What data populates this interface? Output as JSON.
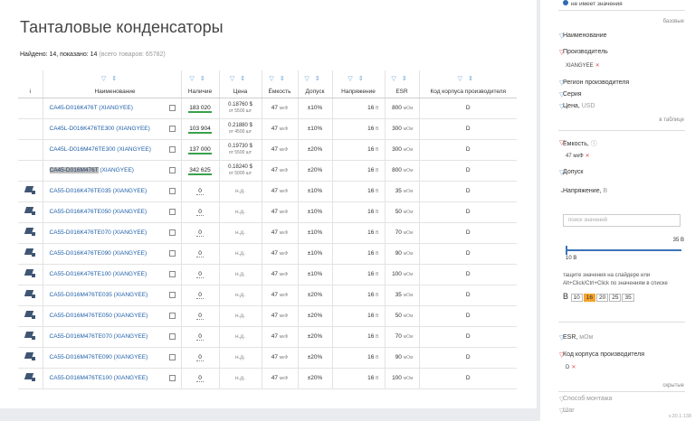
{
  "page_title": "Танталовые конденсаторы",
  "found": {
    "label": "Найдено: 14, показано: 14",
    "total": "(всего товаров: 65782)"
  },
  "columns": {
    "info": "i",
    "name": "Наименование",
    "stock": "Наличие",
    "price": "Цена",
    "capacity": "Ёмкость",
    "tolerance": "Допуск",
    "voltage": "Напряжение",
    "esr": "ESR",
    "package": "Код корпуса производителя"
  },
  "units": {
    "cap": "мкФ",
    "volt": "В",
    "esr": "мОм"
  },
  "rows": [
    {
      "name": "CA45-D016K476T (XIANGYEE)",
      "stock": "183 020",
      "price": "0.18760 $",
      "price_note": "от 5500 шт",
      "cap": "47",
      "tol": "±10%",
      "volt": "16",
      "esr": "800",
      "pkg": "D",
      "img": false
    },
    {
      "name": "CA45L-D016K476TE300 (XIANGYEE)",
      "stock": "103 904",
      "price": "0.21880 $",
      "price_note": "от 4500 шт",
      "cap": "47",
      "tol": "±10%",
      "volt": "16",
      "esr": "300",
      "pkg": "D",
      "img": false
    },
    {
      "name": "CA45L-D016M476TE300 (XIANGYEE)",
      "stock": "137 000",
      "price": "0.19730 $",
      "price_note": "от 5500 шт",
      "cap": "47",
      "tol": "±20%",
      "volt": "16",
      "esr": "300",
      "pkg": "D",
      "img": false
    },
    {
      "name_hl": "CA45-D016M476T",
      "name_rest": " (XIANGYEE)",
      "stock": "342 625",
      "price": "0.18240 $",
      "price_note": "от 5000 шт",
      "cap": "47",
      "tol": "±20%",
      "volt": "16",
      "esr": "800",
      "pkg": "D",
      "img": false
    },
    {
      "name": "CA55-D016K476TE035 (XIANGYEE)",
      "stock": "0",
      "price": "н.д.",
      "cap": "47",
      "tol": "±10%",
      "volt": "16",
      "esr": "35",
      "pkg": "D",
      "img": true
    },
    {
      "name": "CA55-D016K476TE050 (XIANGYEE)",
      "stock": "0",
      "price": "н.д.",
      "cap": "47",
      "tol": "±10%",
      "volt": "16",
      "esr": "50",
      "pkg": "D",
      "img": true
    },
    {
      "name": "CA55-D016K476TE070 (XIANGYEE)",
      "stock": "0",
      "price": "н.д.",
      "cap": "47",
      "tol": "±10%",
      "volt": "16",
      "esr": "70",
      "pkg": "D",
      "img": true
    },
    {
      "name": "CA55-D016K476TE090 (XIANGYEE)",
      "stock": "0",
      "price": "н.д.",
      "cap": "47",
      "tol": "±10%",
      "volt": "16",
      "esr": "90",
      "pkg": "D",
      "img": true
    },
    {
      "name": "CA55-D016K476TE100 (XIANGYEE)",
      "stock": "0",
      "price": "н.д.",
      "cap": "47",
      "tol": "±10%",
      "volt": "16",
      "esr": "100",
      "pkg": "D",
      "img": true
    },
    {
      "name": "CA55-D016M476TE035 (XIANGYEE)",
      "stock": "0",
      "price": "н.д.",
      "cap": "47",
      "tol": "±20%",
      "volt": "16",
      "esr": "35",
      "pkg": "D",
      "img": true
    },
    {
      "name": "CA55-D016M476TE050 (XIANGYEE)",
      "stock": "0",
      "price": "н.д.",
      "cap": "47",
      "tol": "±20%",
      "volt": "16",
      "esr": "50",
      "pkg": "D",
      "img": true
    },
    {
      "name": "CA55-D016M476TE070 (XIANGYEE)",
      "stock": "0",
      "price": "н.д.",
      "cap": "47",
      "tol": "±20%",
      "volt": "16",
      "esr": "70",
      "pkg": "D",
      "img": true
    },
    {
      "name": "CA55-D016M476TE090 (XIANGYEE)",
      "stock": "0",
      "price": "н.д.",
      "cap": "47",
      "tol": "±20%",
      "volt": "16",
      "esr": "90",
      "pkg": "D",
      "img": true
    },
    {
      "name": "CA55-D016M476TE100 (XIANGYEE)",
      "stock": "0",
      "price": "н.д.",
      "cap": "47",
      "tol": "±20%",
      "volt": "16",
      "esr": "100",
      "pkg": "D",
      "img": true
    }
  ],
  "sidebar": {
    "no_value": "не имеет значения",
    "basic": "базовые",
    "name": "Наименование",
    "manufacturer": "Производитель",
    "manufacturer_tag": "XIANGYEE",
    "region": "Регион производителя",
    "series": "Серия",
    "price": "Цена,",
    "price_unit": "USD",
    "in_table": "в таблице",
    "capacity": "Ёмкость,",
    "capacity_tag": "47 мкФ",
    "tolerance": "Допуск",
    "voltage": "Напряжение,",
    "voltage_unit": "В",
    "search_placeholder": "поиск значений",
    "slider_max": "35 В",
    "slider_min": "10 В",
    "hint": "тащите значения на слайдере или Alt+Click/Ctrl+Click по значениям в списке",
    "values_prefix": "В",
    "values": [
      "10",
      "16",
      "20",
      "25",
      "35"
    ],
    "selected_value": "16",
    "esr": "ESR,",
    "esr_unit": "мОм",
    "package": "Код корпуса производителя",
    "package_tag": "D",
    "hidden": "скрытые",
    "mounting": "Способ монтажа",
    "pitch": "Шаг",
    "version": "v.20.1.138"
  }
}
